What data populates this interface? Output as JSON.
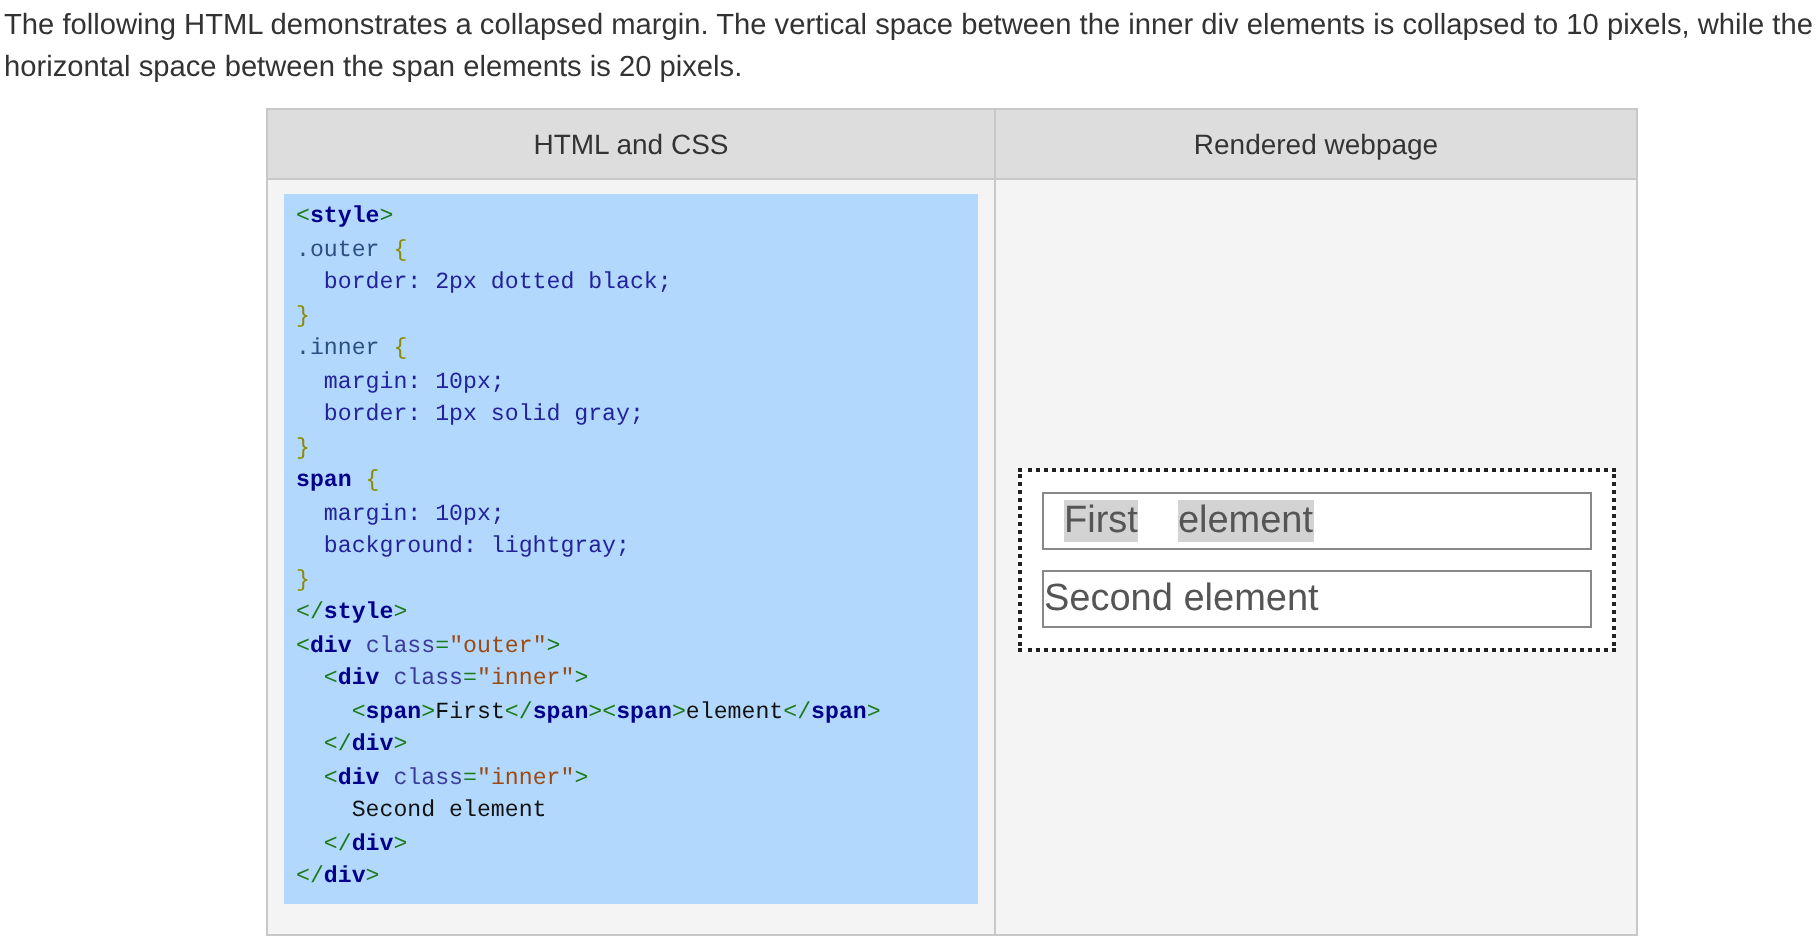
{
  "intro": "The following HTML demonstrates a collapsed margin. The vertical space between the inner div elements is collapsed to 10 pixels, while the horizontal space between the span elements is 20 pixels.",
  "table": {
    "columns": [
      "HTML and CSS",
      "Rendered webpage"
    ],
    "code_lines": [
      [
        {
          "kind": "punct",
          "text": "<"
        },
        {
          "kind": "tag",
          "text": "style"
        },
        {
          "kind": "punct",
          "text": ">"
        }
      ],
      [
        {
          "kind": "selector",
          "text": ".outer "
        },
        {
          "kind": "brace",
          "text": "{"
        }
      ],
      [
        {
          "kind": "prop",
          "text": "  border: 2px dotted black;"
        }
      ],
      [
        {
          "kind": "brace",
          "text": "}"
        }
      ],
      [
        {
          "kind": "selector",
          "text": ".inner "
        },
        {
          "kind": "brace",
          "text": "{"
        }
      ],
      [
        {
          "kind": "prop",
          "text": "  margin: 10px;"
        }
      ],
      [
        {
          "kind": "prop",
          "text": "  border: 1px solid gray;"
        }
      ],
      [
        {
          "kind": "brace",
          "text": "}"
        }
      ],
      [
        {
          "kind": "tag",
          "text": "span "
        },
        {
          "kind": "brace",
          "text": "{"
        }
      ],
      [
        {
          "kind": "prop",
          "text": "  margin: 10px;"
        }
      ],
      [
        {
          "kind": "prop",
          "text": "  background: lightgray;"
        }
      ],
      [
        {
          "kind": "brace",
          "text": "}"
        }
      ],
      [
        {
          "kind": "punct",
          "text": "</"
        },
        {
          "kind": "tag",
          "text": "style"
        },
        {
          "kind": "punct",
          "text": ">"
        }
      ],
      [
        {
          "kind": "punct",
          "text": "<"
        },
        {
          "kind": "tag",
          "text": "div "
        },
        {
          "kind": "attr",
          "text": "class"
        },
        {
          "kind": "punct",
          "text": "="
        },
        {
          "kind": "string",
          "text": "\"outer\""
        },
        {
          "kind": "punct",
          "text": ">"
        }
      ],
      [
        {
          "kind": "punct",
          "text": "  <"
        },
        {
          "kind": "tag",
          "text": "div "
        },
        {
          "kind": "attr",
          "text": "class"
        },
        {
          "kind": "punct",
          "text": "="
        },
        {
          "kind": "string",
          "text": "\"inner\""
        },
        {
          "kind": "punct",
          "text": ">"
        }
      ],
      [
        {
          "kind": "punct",
          "text": "    <"
        },
        {
          "kind": "tag",
          "text": "span"
        },
        {
          "kind": "punct",
          "text": ">"
        },
        {
          "kind": "text",
          "text": "First"
        },
        {
          "kind": "punct",
          "text": "</"
        },
        {
          "kind": "tag",
          "text": "span"
        },
        {
          "kind": "punct",
          "text": "><"
        },
        {
          "kind": "tag",
          "text": "span"
        },
        {
          "kind": "punct",
          "text": ">"
        },
        {
          "kind": "text",
          "text": "element"
        },
        {
          "kind": "punct",
          "text": "</"
        },
        {
          "kind": "tag",
          "text": "span"
        },
        {
          "kind": "punct",
          "text": ">"
        }
      ],
      [
        {
          "kind": "punct",
          "text": "  </"
        },
        {
          "kind": "tag",
          "text": "div"
        },
        {
          "kind": "punct",
          "text": ">"
        }
      ],
      [
        {
          "kind": "punct",
          "text": "  <"
        },
        {
          "kind": "tag",
          "text": "div "
        },
        {
          "kind": "attr",
          "text": "class"
        },
        {
          "kind": "punct",
          "text": "="
        },
        {
          "kind": "string",
          "text": "\"inner\""
        },
        {
          "kind": "punct",
          "text": ">"
        }
      ],
      [
        {
          "kind": "text",
          "text": "    Second element"
        }
      ],
      [
        {
          "kind": "punct",
          "text": "  </"
        },
        {
          "kind": "tag",
          "text": "div"
        },
        {
          "kind": "punct",
          "text": ">"
        }
      ],
      [
        {
          "kind": "punct",
          "text": "</"
        },
        {
          "kind": "tag",
          "text": "div"
        },
        {
          "kind": "punct",
          "text": ">"
        }
      ]
    ],
    "rendered": {
      "first_row": [
        "First",
        "element"
      ],
      "second_row": "Second element"
    }
  }
}
